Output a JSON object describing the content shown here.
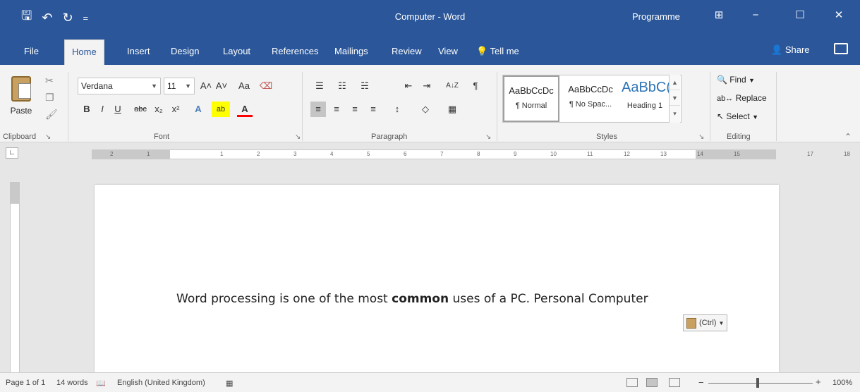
{
  "window": {
    "title": "Computer - Word",
    "user": "Programme",
    "minimize_glyph": "−",
    "maximize_glyph": "☐",
    "close_glyph": "✕",
    "ribbon_display_glyph": "⊞"
  },
  "qat": {
    "save_glyph": "🖫",
    "undo_glyph": "↶",
    "redo_glyph": "↻",
    "customize_glyph": "="
  },
  "tabs": [
    {
      "label": "File"
    },
    {
      "label": "Home"
    },
    {
      "label": "Insert"
    },
    {
      "label": "Design"
    },
    {
      "label": "Layout"
    },
    {
      "label": "References"
    },
    {
      "label": "Mailings"
    },
    {
      "label": "Review"
    },
    {
      "label": "View"
    },
    {
      "label": "Tell me"
    }
  ],
  "active_tab": "Home",
  "share_label": "Share",
  "ribbon": {
    "clipboard": {
      "paste_label": "Paste",
      "group_label": "Clipboard"
    },
    "font": {
      "font_name": "Verdana",
      "font_size": "11",
      "grow": "A˄",
      "shrink": "A˅",
      "change_case": "Aa",
      "clear_format": "⌫",
      "bold": "B",
      "italic": "I",
      "underline": "U",
      "strikethrough": "abc",
      "subscript": "x₂",
      "superscript": "x²",
      "text_effects": "A",
      "highlight": "ab",
      "font_color": "A",
      "group_label": "Font"
    },
    "paragraph": {
      "bullets": "☰",
      "numbering": "☷",
      "multilevel": "☵",
      "decrease_indent": "⇤",
      "increase_indent": "⇥",
      "sort": "A↓Z",
      "show_marks": "¶",
      "align_left": "≡",
      "center": "≡",
      "align_right": "≡",
      "justify": "≡",
      "line_spacing": "↕",
      "shading": "◇",
      "borders": "▦",
      "group_label": "Paragraph"
    },
    "styles": {
      "items": [
        {
          "sample": "AaBbCcDc",
          "name": "¶ Normal"
        },
        {
          "sample": "AaBbCcDc",
          "name": "¶ No Spac..."
        },
        {
          "sample": "AaBbC(",
          "name": "Heading 1"
        }
      ],
      "group_label": "Styles"
    },
    "editing": {
      "find": "Find",
      "replace": "Replace",
      "select": "Select",
      "group_label": "Editing"
    }
  },
  "document": {
    "text_before": "Word processing is one of the most ",
    "text_bold": "common",
    "text_after": " uses of a PC. Personal Computer",
    "paste_options": "(Ctrl)"
  },
  "ruler": {
    "ticks": [
      "2",
      "1",
      "",
      "1",
      "2",
      "3",
      "4",
      "5",
      "6",
      "7",
      "8",
      "9",
      "10",
      "11",
      "12",
      "13",
      "14",
      "15",
      "",
      "17",
      "18"
    ]
  },
  "status": {
    "page": "Page 1 of 1",
    "words": "14 words",
    "language": "English (United Kingdom)",
    "zoom": "100%",
    "zoom_out": "−",
    "zoom_in": "+"
  },
  "colors": {
    "title_bar": "#2b579a",
    "ribbon": "#f3f3f3",
    "heading_blue": "#2e74b5"
  }
}
